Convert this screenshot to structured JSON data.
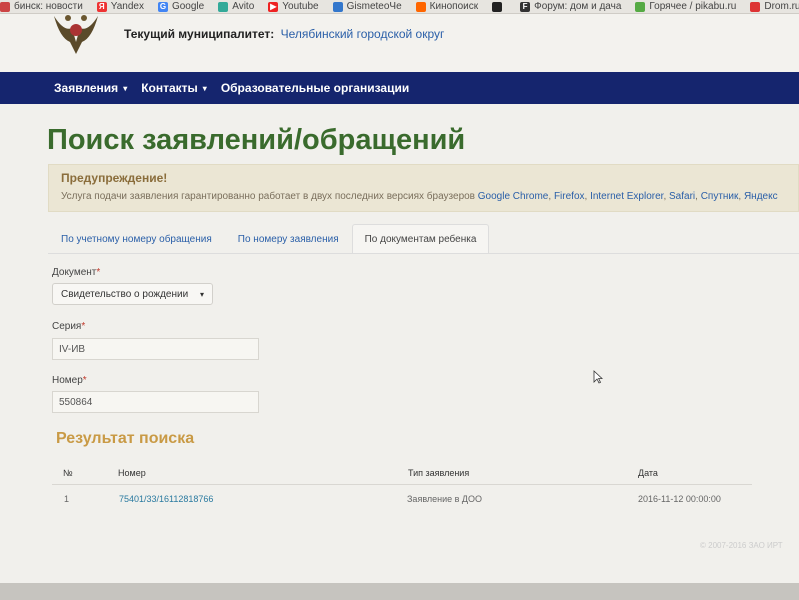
{
  "bookmarks": [
    {
      "label": "бинск: новости",
      "icon": "news-icon",
      "color": "#c44"
    },
    {
      "label": "Yandex",
      "icon": "yandex-icon",
      "color": "#e33"
    },
    {
      "label": "Google",
      "icon": "google-icon",
      "color": "#4285f4"
    },
    {
      "label": "Avito",
      "icon": "avito-icon",
      "color": "#3a9"
    },
    {
      "label": "Youtube",
      "icon": "youtube-icon",
      "color": "#e22"
    },
    {
      "label": "GismeteoЧе",
      "icon": "gismeteo-icon",
      "color": "#37c"
    },
    {
      "label": "Кинопоиск",
      "icon": "kinopoisk-icon",
      "color": "#f60"
    },
    {
      "label": "",
      "icon": "app-icon",
      "color": "#222"
    },
    {
      "label": "Форум: дом и дача",
      "icon": "forum-icon",
      "color": "#333"
    },
    {
      "label": "Горячее / pikabu.ru",
      "icon": "pikabu-icon",
      "color": "#5a4"
    },
    {
      "label": "Drom.ru - автомоби",
      "icon": "drom-icon",
      "color": "#d33"
    }
  ],
  "header": {
    "municipality_label": "Текущий муниципалитет:",
    "municipality_value": "Челябинский городской округ",
    "emblem_icon": "coat-of-arms-icon"
  },
  "nav": {
    "items": [
      {
        "label": "Заявления",
        "caret": "▾"
      },
      {
        "label": "Контакты",
        "caret": "▾"
      },
      {
        "label": "Образовательные организации",
        "caret": ""
      }
    ]
  },
  "page": {
    "title": "Поиск заявлений/обращений"
  },
  "alert": {
    "title": "Предупреждение!",
    "text": "Услуга подачи заявления гарантированно работает в двух последних версиях браузеров",
    "browsers": [
      "Google Chrome",
      "Firefox",
      "Internet Explorer",
      "Safari",
      "Спутник",
      "Яндекс"
    ],
    "sep": ","
  },
  "tabs": [
    {
      "label": "По учетному номеру обращения",
      "active": false
    },
    {
      "label": "По номеру заявления",
      "active": false
    },
    {
      "label": "По документам ребенка",
      "active": true
    }
  ],
  "form": {
    "document_label": "Документ",
    "document_value": "Свидетельство о рождении",
    "series_label": "Серия",
    "series_value": "IV-ИВ",
    "number_label": "Номер",
    "number_value": "550864",
    "required_mark": "*"
  },
  "results": {
    "title": "Результат поиска",
    "columns": [
      "№",
      "Номер",
      "Тип заявления",
      "Дата"
    ],
    "rows": [
      {
        "num": "1",
        "number": "75401/33/16112818766",
        "type": "Заявление в ДОО",
        "date": "2016-11-12 00:00:00"
      }
    ]
  },
  "footer": {
    "text": "© 2007-2016 ЗАО ИРТ"
  },
  "colors": {
    "nav_bg": "#15256e",
    "title": "#3a6b2d",
    "result_title": "#c99a45",
    "link": "#2a5fa8"
  }
}
